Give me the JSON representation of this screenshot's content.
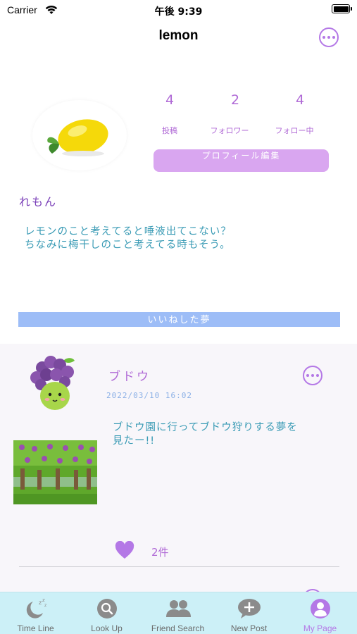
{
  "status_bar": {
    "carrier": "Carrier",
    "time": "午後 9:39"
  },
  "nav": {
    "title": "lemon",
    "more_icon": "ellipsis-circle-icon"
  },
  "profile": {
    "avatar": "lemon",
    "stats": [
      {
        "value": "4",
        "label": "投稿"
      },
      {
        "value": "2",
        "label": "フォロワー"
      },
      {
        "value": "4",
        "label": "フォロー中"
      }
    ],
    "edit_button": "プロフィール編集",
    "display_name": "れもん",
    "bio_lines": [
      "レモンのこと考えてると唾液出てこない？",
      "ちなみに梅干しのこと考えてる時もそう。"
    ]
  },
  "liked_section": {
    "title": "いいねした夢"
  },
  "posts": [
    {
      "user": "ブドウ",
      "avatar": "grape-character",
      "timestamp": "2022/03/10 16:02",
      "text_lines": [
        "ブドウ園に行ってブドウ狩りする夢を",
        "見たー!!"
      ],
      "image": "vineyard",
      "like_icon": "heart-icon",
      "likes": "2件"
    }
  ],
  "tabs": [
    {
      "label": "Time Line",
      "icon": "moon-zzz-icon"
    },
    {
      "label": "Look Up",
      "icon": "search-icon"
    },
    {
      "label": "Friend Search",
      "icon": "people-icon"
    },
    {
      "label": "New Post",
      "icon": "plus-bubble-icon"
    },
    {
      "label": "My Page",
      "icon": "person-icon"
    }
  ],
  "colors": {
    "accent_purple": "#b478e6",
    "bio_text": "#3a9bb5",
    "edit_button": "#d9a6f0",
    "section_header": "#9dbdf7",
    "tab_bar": "#ccf0f7"
  }
}
